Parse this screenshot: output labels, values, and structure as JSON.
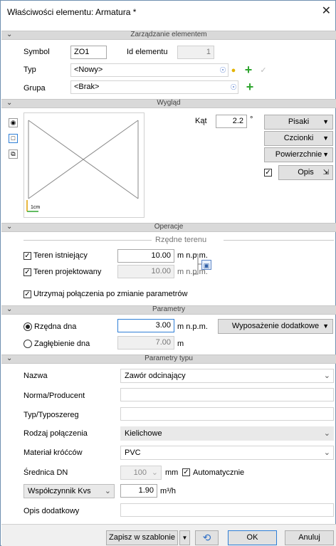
{
  "window": {
    "title": "Właściwości elementu: Armatura *",
    "close_glyph": "✕"
  },
  "sections": {
    "management": "Zarządzanie elementem",
    "appearance": "Wygląd",
    "operations": "Operacje",
    "parameters": "Parametry",
    "type_parameters": "Parametry typu"
  },
  "management": {
    "symbol_label": "Symbol",
    "symbol_value": "ZO1",
    "id_label": "Id elementu",
    "id_value": "1",
    "type_label": "Typ",
    "type_value": "<Nowy>",
    "group_label": "Grupa",
    "group_value": "<Brak>"
  },
  "appearance": {
    "angle_label": "Kąt",
    "angle_value": "2.2",
    "angle_unit": "°",
    "pens_button": "Pisaki",
    "fonts_button": "Czcionki",
    "surfaces_button": "Powierzchnie",
    "desc_button": "Opis",
    "desc_checked": true,
    "scale_label": "1cm"
  },
  "operations": {
    "terrain_group": "Rzędne terenu",
    "existing_label": "Teren istniejący",
    "existing_value": "10.00",
    "existing_unit": "m n.p.m.",
    "designed_label": "Teren projektowany",
    "designed_value": "10.00",
    "designed_unit": "m n.p.m.",
    "keep_label": "Utrzymaj połączenia po zmianie parametrów"
  },
  "parameters": {
    "bottom_label": "Rzędna dna",
    "bottom_value": "3.00",
    "bottom_unit": "m n.p.m.",
    "depth_label": "Zagłębienie dna",
    "depth_value": "7.00",
    "depth_unit": "m",
    "equipment_button": "Wyposażenie dodatkowe"
  },
  "type_params": {
    "name_label": "Nazwa",
    "name_value": "Zawór odcinający",
    "norm_label": "Norma/Producent",
    "norm_value": "",
    "series_label": "Typ/Typoszereg",
    "series_value": "",
    "connection_label": "Rodzaj połączenia",
    "connection_value": "Kielichowe",
    "material_label": "Materiał króćców",
    "material_value": "PVC",
    "dn_label": "Średnica DN",
    "dn_value": "100",
    "dn_unit": "mm",
    "auto_label": "Automatycznie",
    "kvs_label": "Współczynnik Kvs",
    "kvs_value": "1.90",
    "kvs_unit": "m³/h",
    "desc_label": "Opis dodatkowy",
    "desc_value": ""
  },
  "footer": {
    "save_template": "Zapisz w szablonie",
    "ok": "OK",
    "cancel": "Anuluj"
  },
  "colors": {
    "accent": "#2f7fd6",
    "section_bg": "#d9d9d9",
    "plus": "#2fa52f"
  }
}
